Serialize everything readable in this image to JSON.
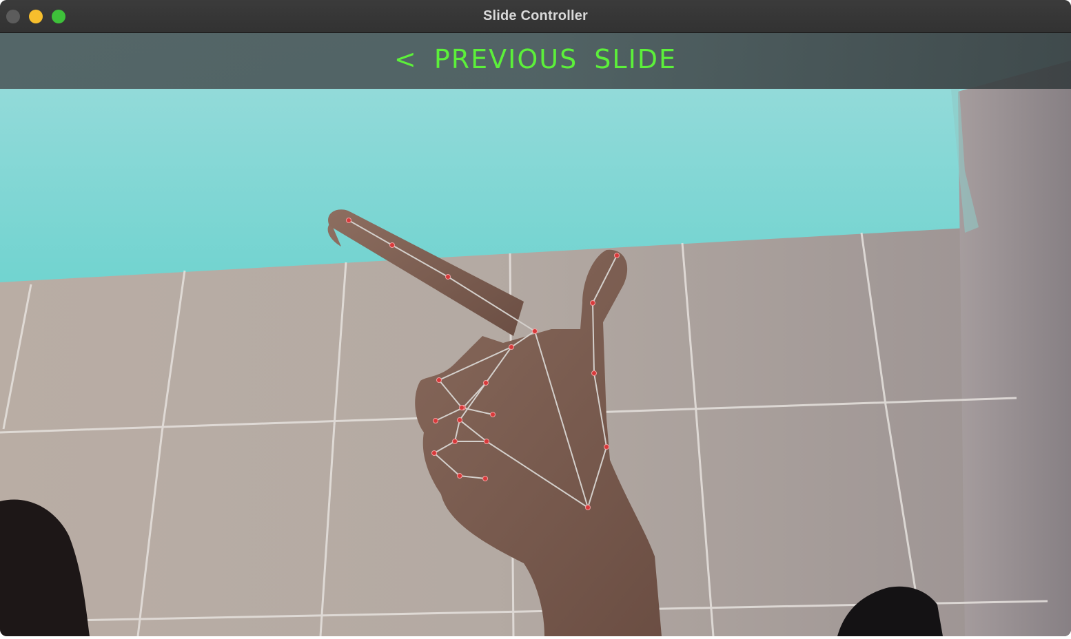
{
  "window": {
    "title": "Slide Controller",
    "controls": [
      {
        "name": "close",
        "color": "#5c5c5c"
      },
      {
        "name": "minimize",
        "color": "#f6be2d"
      },
      {
        "name": "zoom",
        "color": "#3ec13a"
      }
    ]
  },
  "overlay": {
    "gesture_label": "< PREVIOUS SLIDE",
    "label_color": "#5cf03a"
  },
  "hand_tracking": {
    "landmark_color": "#d8393a",
    "connection_color": "#d4d0cc"
  }
}
